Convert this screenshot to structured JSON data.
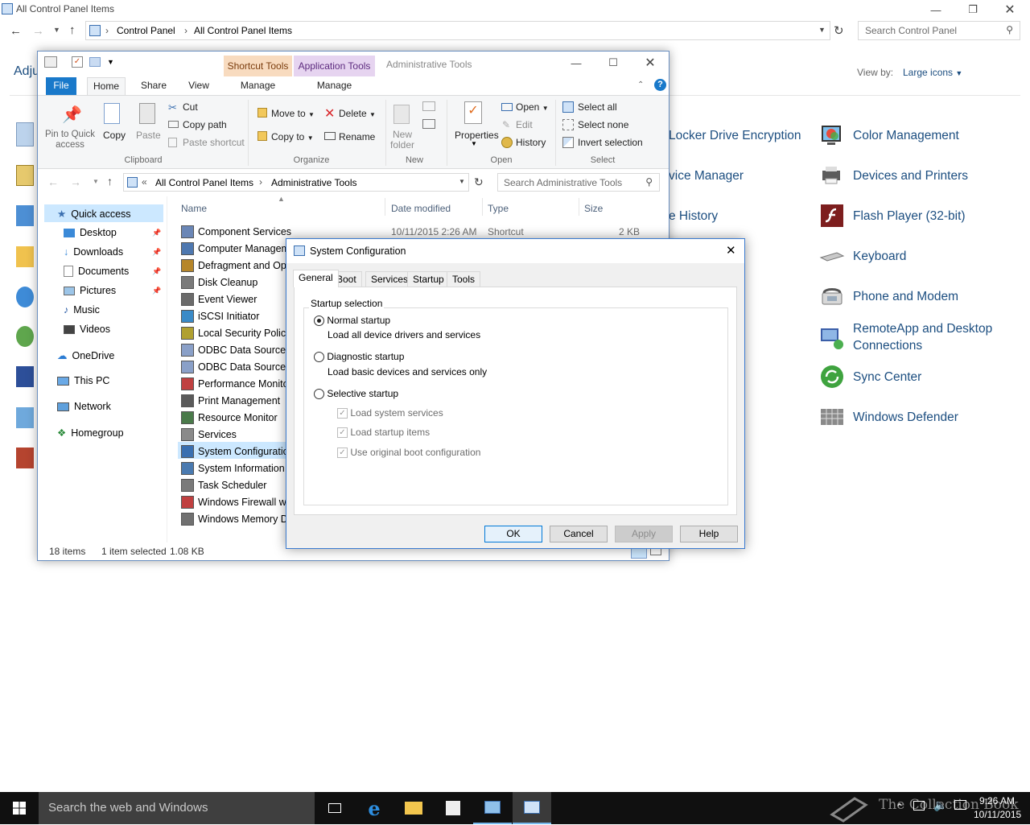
{
  "control_panel": {
    "title": "All Control Panel Items",
    "breadcrumb": [
      "Control Panel",
      "All Control Panel Items"
    ],
    "search_placeholder": "Search Control Panel",
    "heading_partial": "Adju",
    "view_by_label": "View by:",
    "view_by_value": "Large icons",
    "items": [
      {
        "label": "Locker Drive Encryption",
        "icon": "bitlocker-icon"
      },
      {
        "label": "vice Manager",
        "icon": "device-manager-icon"
      },
      {
        "label": "e History",
        "icon": "file-history-icon"
      },
      {
        "label": "Color Management",
        "icon": "color-management-icon"
      },
      {
        "label": "Devices and Printers",
        "icon": "devices-printers-icon"
      },
      {
        "label": "Flash Player (32-bit)",
        "icon": "flash-icon"
      },
      {
        "label": "Keyboard",
        "icon": "keyboard-icon"
      },
      {
        "label": "Phone and Modem",
        "icon": "phone-modem-icon"
      },
      {
        "label": "RemoteApp and Desktop Connections",
        "icon": "remoteapp-icon"
      },
      {
        "label": "Sync Center",
        "icon": "sync-center-icon"
      },
      {
        "label": "Windows Defender",
        "icon": "defender-icon"
      }
    ]
  },
  "explorer": {
    "title": "Administrative Tools",
    "context_tabs": [
      "Shortcut Tools",
      "Application Tools"
    ],
    "tabs": [
      "File",
      "Home",
      "Share",
      "View",
      "Manage",
      "Manage"
    ],
    "ribbon": {
      "pin_label": "Pin to Quick access",
      "copy": "Copy",
      "paste": "Paste",
      "cut": "Cut",
      "copy_path": "Copy path",
      "paste_shortcut": "Paste shortcut",
      "move_to": "Move to",
      "copy_to": "Copy to",
      "delete": "Delete",
      "rename": "Rename",
      "new_folder": "New folder",
      "properties": "Properties",
      "open": "Open",
      "edit": "Edit",
      "history": "History",
      "select_all": "Select all",
      "select_none": "Select none",
      "invert_selection": "Invert selection",
      "groups": [
        "Clipboard",
        "Organize",
        "New",
        "Open",
        "Select"
      ]
    },
    "address": [
      "All Control Panel Items",
      "Administrative Tools"
    ],
    "search_placeholder": "Search Administrative Tools",
    "nav": [
      "Quick access",
      "Desktop",
      "Downloads",
      "Documents",
      "Pictures",
      "Music",
      "Videos",
      "OneDrive",
      "This PC",
      "Network",
      "Homegroup"
    ],
    "columns": [
      "Name",
      "Date modified",
      "Type",
      "Size"
    ],
    "first_row": {
      "date": "10/11/2015 2:26 AM",
      "type": "Shortcut",
      "size": "2 KB"
    },
    "files": [
      "Component Services",
      "Computer Managem",
      "Defragment and Opt",
      "Disk Cleanup",
      "Event Viewer",
      "iSCSI Initiator",
      "Local Security Policy",
      "ODBC Data Sources (",
      "ODBC Data Sources (",
      "Performance Monito",
      "Print Management",
      "Resource Monitor",
      "Services",
      "System Configuration",
      "System Information",
      "Task Scheduler",
      "Windows Firewall wit",
      "Windows Memory Di"
    ],
    "status": {
      "count": "18 items",
      "selected": "1 item selected",
      "size": "1.08 KB"
    }
  },
  "dialog": {
    "title": "System Configuration",
    "tabs": [
      "General",
      "Boot",
      "Services",
      "Startup",
      "Tools"
    ],
    "group_label": "Startup selection",
    "normal": "Normal startup",
    "normal_desc": "Load all device drivers and services",
    "diagnostic": "Diagnostic startup",
    "diagnostic_desc": "Load basic devices and services only",
    "selective": "Selective startup",
    "chk_services": "Load system services",
    "chk_startup": "Load startup items",
    "chk_boot": "Use original boot configuration",
    "buttons": {
      "ok": "OK",
      "cancel": "Cancel",
      "apply": "Apply",
      "help": "Help"
    }
  },
  "taskbar": {
    "search": "Search the web and Windows",
    "time": "9:26 AM",
    "date": "10/11/2015",
    "watermark": "The Collection Book"
  }
}
